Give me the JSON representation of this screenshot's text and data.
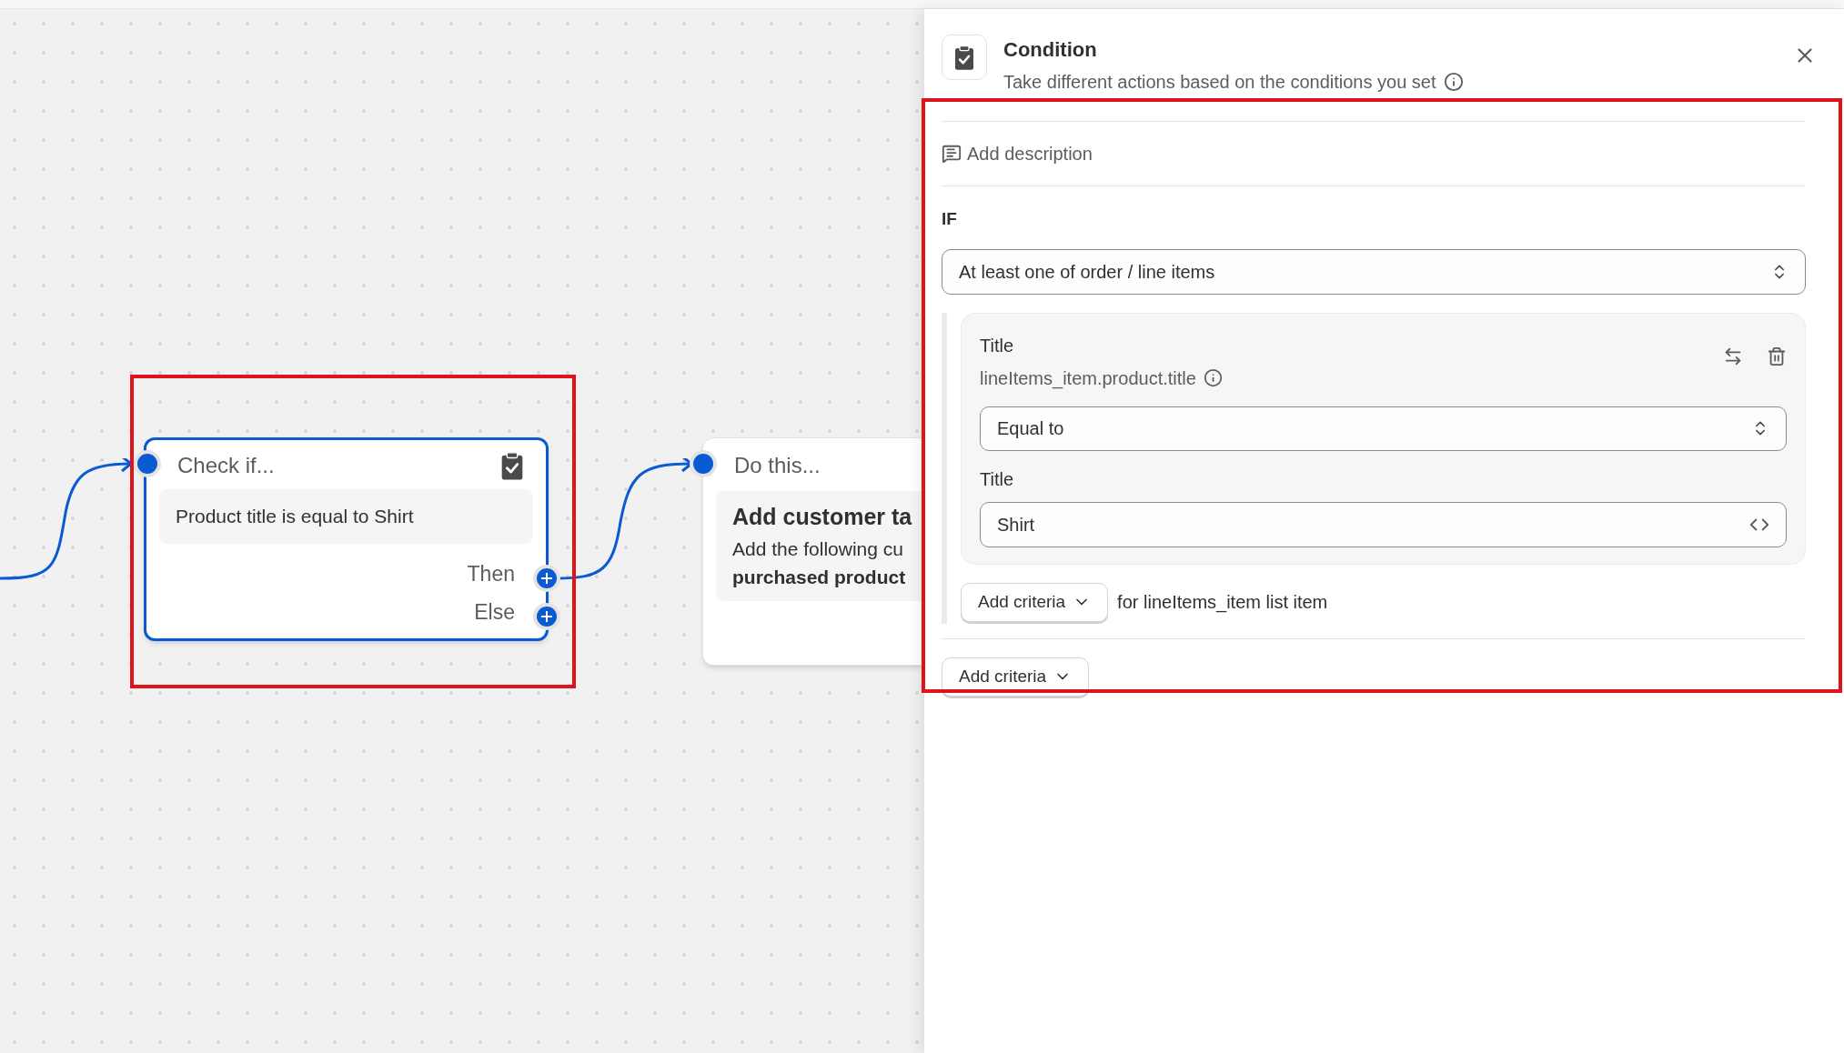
{
  "canvas": {
    "nodes": [
      {
        "kind": "condition",
        "selected": true,
        "heading": "Check if...",
        "summary": "Product title is equal to Shirt",
        "outputs": [
          "Then",
          "Else"
        ]
      },
      {
        "kind": "action",
        "selected": false,
        "heading": "Do this...",
        "title": "Add customer ta",
        "description": "Add the following cu",
        "detail": "purchased product"
      }
    ]
  },
  "panel": {
    "title": "Condition",
    "subtitle": "Take different actions based on the conditions you set",
    "description_button": "Add description",
    "section_label": "IF",
    "scope_select": "At least one of order / line items",
    "criteria": [
      {
        "label": "Title",
        "path": "lineItems_item.product.title",
        "operator": "Equal to",
        "value_label": "Title",
        "value": "Shirt"
      }
    ],
    "group_add_button": "Add criteria",
    "group_note": "for lineItems_item list item",
    "add_button": "Add criteria"
  }
}
